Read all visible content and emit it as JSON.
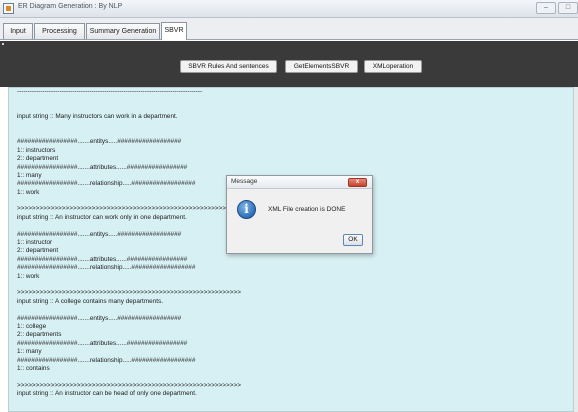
{
  "window": {
    "title": "ER Diagram Generation : By NLP",
    "icons": {
      "app": "app-icon",
      "minimize": "minimize-icon",
      "maximize": "maximize-icon"
    }
  },
  "tabs": [
    {
      "label": "Input"
    },
    {
      "label": "Processing"
    },
    {
      "label": "Summary Generation"
    },
    {
      "label": "SBVR",
      "active": true
    }
  ],
  "toolbar": {
    "buttons": [
      {
        "label": "SBVR Rules And sentences"
      },
      {
        "label": "GetElementsSBVR"
      },
      {
        "label": "XMLoperation"
      }
    ]
  },
  "output": {
    "lines": [
      "---------------------------------------------------------------------------------------",
      "",
      "",
      "input string :: Many instructors can work in a department.",
      "",
      "",
      "#################.......entitys.....##################",
      "1:: instructors",
      "2:: department",
      "#################.......attributes......#################",
      "1:: many",
      "#################.......relationship.....##################",
      "1:: work",
      "",
      ">>>>>>>>>>>>>>>>>>>>>>>>>>>>>>>>>>>>>>>>>>>>>>>>>>>>>>>>>>>>",
      "input string :: An instructor can work only in one department.",
      "",
      "#################.......entitys.....##################",
      "1:: instructor",
      "2:: department",
      "#################.......attributes......#################",
      "#################.......relationship.....##################",
      "1:: work",
      "",
      ">>>>>>>>>>>>>>>>>>>>>>>>>>>>>>>>>>>>>>>>>>>>>>>>>>>>>>>>>>>>",
      "input string :: A college contains many departments.",
      "",
      "#################.......entitys.....##################",
      "1:: college",
      "2:: departments",
      "#################.......attributes......#################",
      "1:: many",
      "#################.......relationship.....##################",
      "1:: contains",
      "",
      ">>>>>>>>>>>>>>>>>>>>>>>>>>>>>>>>>>>>>>>>>>>>>>>>>>>>>>>>>>>>",
      "input string :: An instructor can be head of only one department."
    ]
  },
  "dialog": {
    "title": "Message",
    "message": "XML File creation is DONE",
    "ok_label": "OK",
    "close_glyph": "x",
    "icon": "info-icon",
    "icon_glyph": "i"
  }
}
